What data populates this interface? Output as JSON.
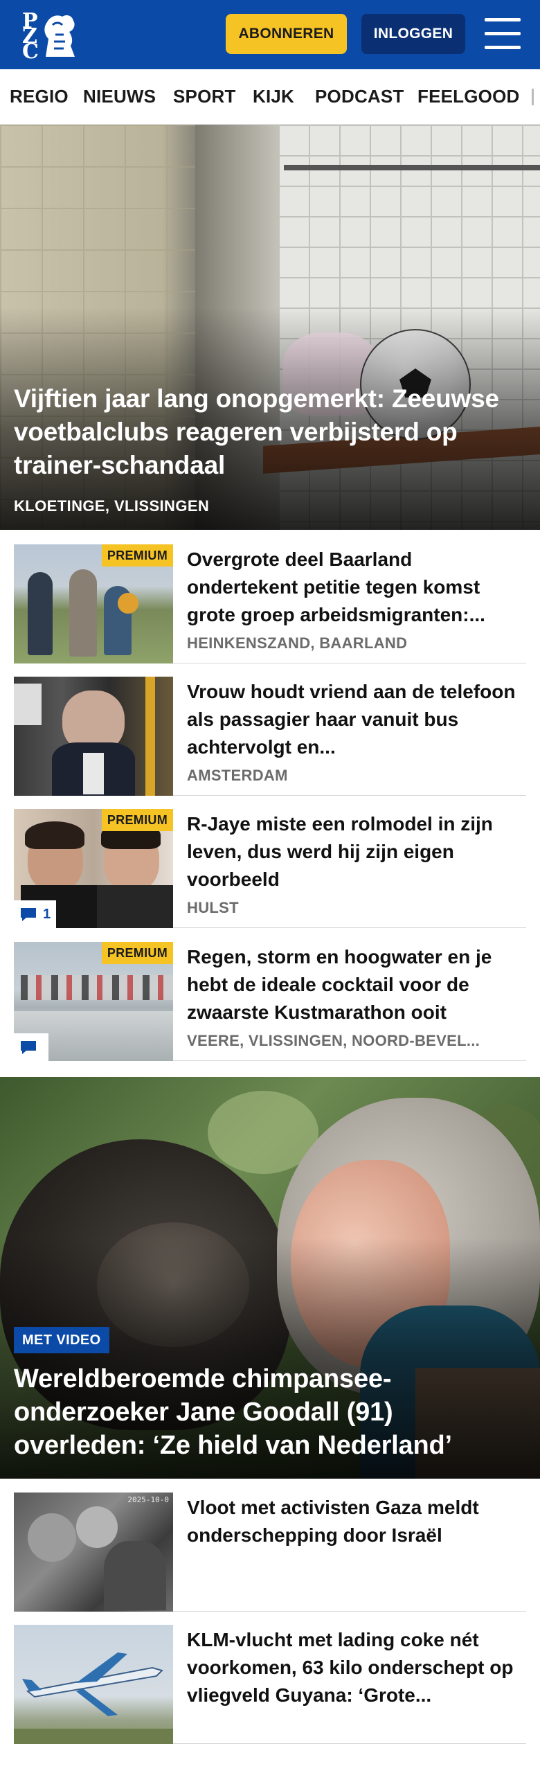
{
  "header": {
    "logo_text": "PZC",
    "subscribe_label": "ABONNEREN",
    "login_label": "INLOGGEN",
    "menu_icon": "hamburger-menu-icon",
    "colors": {
      "brand_blue": "#0b4aa6",
      "subscribe_yellow": "#f6c325",
      "login_navy": "#0a2f73"
    }
  },
  "nav": {
    "items": [
      "REGIO",
      "NIEUWS",
      "SPORT",
      "KIJK",
      "PODCAST",
      "FEELGOOD"
    ]
  },
  "hero": {
    "title": "Vijftien jaar lang onopgemerkt: Zeeuwse voetbalclubs reageren verbijsterd op trainer-schandaal",
    "location": "KLOETINGE, VLISSINGEN"
  },
  "articles": [
    {
      "title": "Overgrote deel Baarland ondertekent petitie tegen komst grote groep arbeidsmigranten:...",
      "location": "HEINKENSZAND, BAARLAND",
      "premium": "PREMIUM"
    },
    {
      "title": "Vrouw houdt vriend aan de telefoon als passagier haar vanuit bus achtervolgt en...",
      "location": "AMSTERDAM"
    },
    {
      "title": "R-Jaye miste een rolmodel in zijn leven, dus werd hij zijn eigen voorbeeld",
      "location": "HULST",
      "premium": "PREMIUM",
      "comments": "1"
    },
    {
      "title": "Regen, storm en hoogwater en je hebt de ideale cocktail voor de zwaarste Kustmarathon ooit",
      "location": "VEERE, VLISSINGEN, NOORD-BEVEL...",
      "premium": "PREMIUM",
      "comments": ""
    }
  ],
  "hero2": {
    "badge": "MET VIDEO",
    "title": "Wereldberoemde chimpansee-onderzoeker Jane Goodall (91) overleden: ‘Ze hield van Nederland’"
  },
  "articles2": [
    {
      "title": "Vloot met activisten Gaza meldt onderschepping door Israël",
      "thumb_stamp": "2025-10-0"
    },
    {
      "title": "KLM-vlucht met lading coke nét voorkomen, 63 kilo onderschept op vliegveld Guyana: ‘Grote..."
    }
  ]
}
